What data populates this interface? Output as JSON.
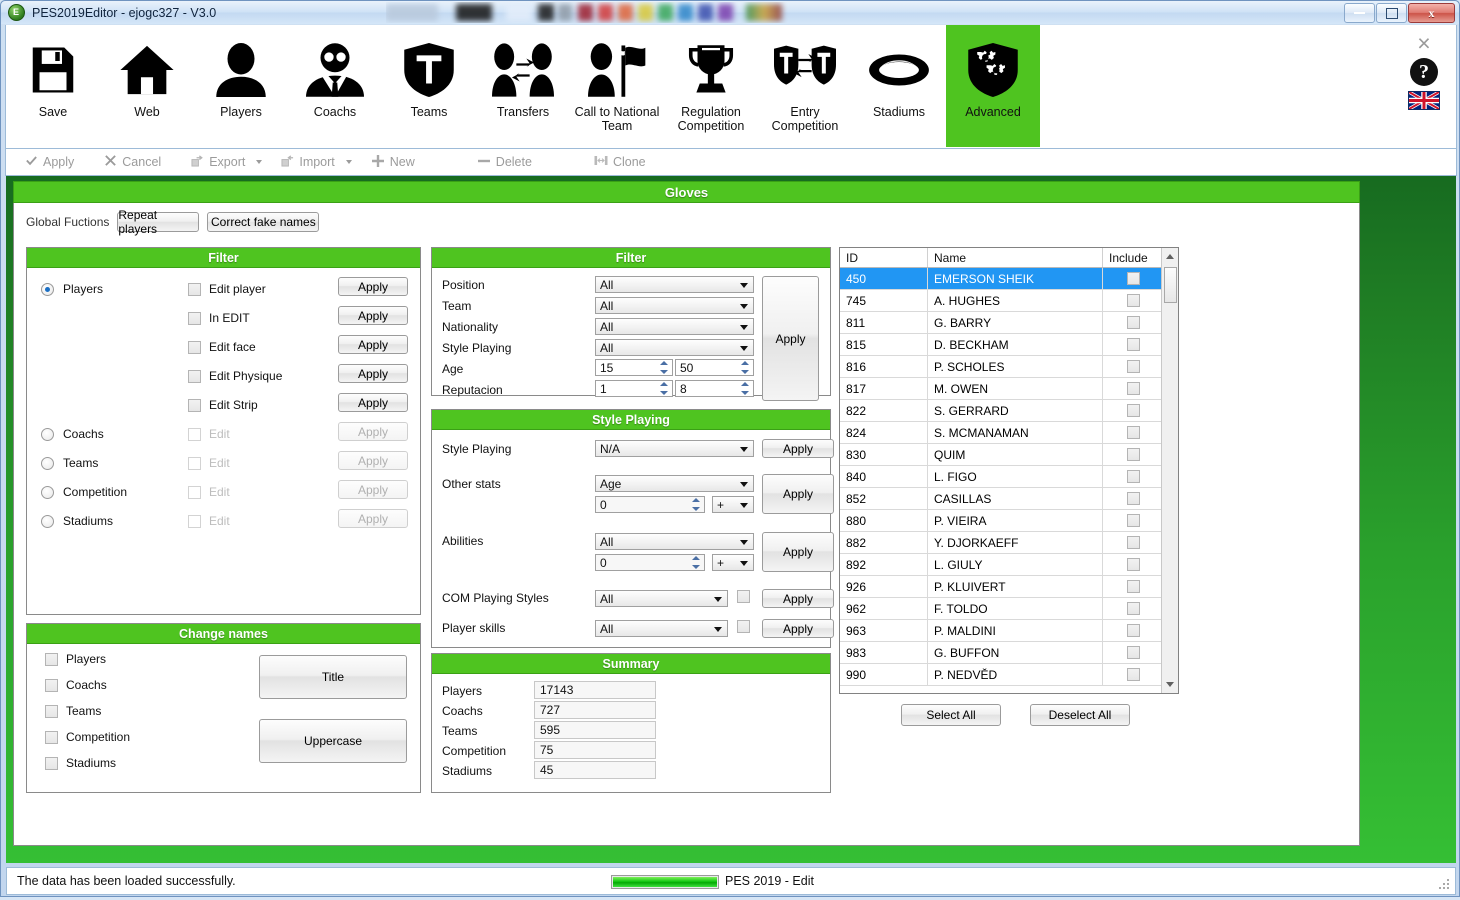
{
  "window": {
    "title": "PES2019Editor - ejogc327 - V3.0",
    "minimize_label": "Minimize",
    "maximize_label": "Maximize",
    "close_label": "x"
  },
  "toolbar": {
    "items": [
      {
        "label": "Save",
        "icon": "floppy-disk-icon"
      },
      {
        "label": "Web",
        "icon": "home-icon"
      },
      {
        "label": "Players",
        "icon": "person-icon"
      },
      {
        "label": "Coachs",
        "icon": "coach-suit-icon"
      },
      {
        "label": "Teams",
        "icon": "shield-t-icon"
      },
      {
        "label": "Transfers",
        "icon": "two-people-swap-icon"
      },
      {
        "label": "Call to National Team",
        "icon": "person-flag-icon"
      },
      {
        "label": "Regulation Competition",
        "icon": "trophy-icon"
      },
      {
        "label": "Entry Competition",
        "icon": "two-shields-swap-icon"
      },
      {
        "label": "Stadiums",
        "icon": "stadium-icon"
      },
      {
        "label": "Advanced",
        "icon": "shield-gears-icon",
        "active": true
      }
    ],
    "close_label": "×",
    "help_label": "?",
    "language_flag": "union-jack-flag"
  },
  "commandbar": {
    "items": [
      {
        "label": "Apply",
        "icon": "check-icon",
        "dropdown": false
      },
      {
        "label": "Cancel",
        "icon": "cross-icon",
        "dropdown": false
      },
      {
        "label": "Export",
        "icon": "export-icon",
        "dropdown": true
      },
      {
        "label": "Import",
        "icon": "import-icon",
        "dropdown": true
      },
      {
        "label": "New",
        "icon": "plus-icon",
        "dropdown": false
      },
      {
        "label": "Delete",
        "icon": "minus-icon",
        "dropdown": false
      },
      {
        "label": "Clone",
        "icon": "clone-icon",
        "dropdown": false
      }
    ]
  },
  "page": {
    "header_title": "Gloves",
    "global_functions_label": "Global Fuctions",
    "global_buttons": [
      "Repeat players",
      "Correct fake names"
    ]
  },
  "filter_left": {
    "title": "Filter",
    "rows": [
      {
        "radio": "Players",
        "selected": true,
        "check": "Edit player",
        "apply": "Apply",
        "enabled": true
      },
      {
        "radio": "",
        "selected": false,
        "check": "In EDIT",
        "apply": "Apply",
        "enabled": true
      },
      {
        "radio": "",
        "selected": false,
        "check": "Edit face",
        "apply": "Apply",
        "enabled": true
      },
      {
        "radio": "",
        "selected": false,
        "check": "Edit Physique",
        "apply": "Apply",
        "enabled": true
      },
      {
        "radio": "",
        "selected": false,
        "check": "Edit Strip",
        "apply": "Apply",
        "enabled": true
      },
      {
        "radio": "Coachs",
        "selected": false,
        "check": "Edit",
        "apply": "Apply",
        "enabled": false
      },
      {
        "radio": "Teams",
        "selected": false,
        "check": "Edit",
        "apply": "Apply",
        "enabled": false
      },
      {
        "radio": "Competition",
        "selected": false,
        "check": "Edit",
        "apply": "Apply",
        "enabled": false
      },
      {
        "radio": "Stadiums",
        "selected": false,
        "check": "Edit",
        "apply": "Apply",
        "enabled": false
      }
    ]
  },
  "change_names": {
    "title": "Change names",
    "checks": [
      "Players",
      "Coachs",
      "Teams",
      "Competition",
      "Stadiums"
    ],
    "buttons": [
      "Title",
      "Uppercase"
    ]
  },
  "filter_center": {
    "title": "Filter",
    "apply_label": "Apply",
    "fields": [
      {
        "label": "Position",
        "value": "All",
        "type": "combo"
      },
      {
        "label": "Team",
        "value": "All",
        "type": "combo"
      },
      {
        "label": "Nationality",
        "value": "All",
        "type": "combo"
      },
      {
        "label": "Style Playing",
        "value": "All",
        "type": "combo"
      }
    ],
    "ranges": [
      {
        "label": "Age",
        "min": "15",
        "max": "50"
      },
      {
        "label": "Reputacion",
        "min": "1",
        "max": "8"
      }
    ]
  },
  "style_playing": {
    "title": "Style Playing",
    "style_label": "Style Playing",
    "style_value": "N/A",
    "style_apply": "Apply",
    "other_stats_label": "Other stats",
    "other_stats_value": "Age",
    "other_stats_number": "0",
    "other_stats_op": "+",
    "other_stats_apply": "Apply",
    "abilities_label": "Abilities",
    "abilities_value": "All",
    "abilities_number": "0",
    "abilities_op": "+",
    "abilities_apply": "Apply",
    "com_label": "COM Playing Styles",
    "com_value": "All",
    "com_apply": "Apply",
    "skills_label": "Player skills",
    "skills_value": "All",
    "skills_apply": "Apply"
  },
  "summary": {
    "title": "Summary",
    "rows": [
      {
        "label": "Players",
        "value": "17143"
      },
      {
        "label": "Coachs",
        "value": "727"
      },
      {
        "label": "Teams",
        "value": "595"
      },
      {
        "label": "Competition",
        "value": "75"
      },
      {
        "label": "Stadiums",
        "value": "45"
      }
    ]
  },
  "player_table": {
    "columns": [
      "ID",
      "Name",
      "Include"
    ],
    "rows": [
      {
        "id": "450",
        "name": "EMERSON SHEIK",
        "include": false,
        "selected": true
      },
      {
        "id": "745",
        "name": "A. HUGHES",
        "include": false,
        "selected": false
      },
      {
        "id": "811",
        "name": "G. BARRY",
        "include": false,
        "selected": false
      },
      {
        "id": "815",
        "name": "D. BECKHAM",
        "include": false,
        "selected": false
      },
      {
        "id": "816",
        "name": "P. SCHOLES",
        "include": false,
        "selected": false
      },
      {
        "id": "817",
        "name": "M. OWEN",
        "include": false,
        "selected": false
      },
      {
        "id": "822",
        "name": "S. GERRARD",
        "include": false,
        "selected": false
      },
      {
        "id": "824",
        "name": "S. MCMANAMAN",
        "include": false,
        "selected": false
      },
      {
        "id": "830",
        "name": "QUIM",
        "include": false,
        "selected": false
      },
      {
        "id": "840",
        "name": "L. FIGO",
        "include": false,
        "selected": false
      },
      {
        "id": "852",
        "name": "CASILLAS",
        "include": false,
        "selected": false
      },
      {
        "id": "880",
        "name": "P. VIEIRA",
        "include": false,
        "selected": false
      },
      {
        "id": "882",
        "name": "Y. DJORKAEFF",
        "include": false,
        "selected": false
      },
      {
        "id": "892",
        "name": "L. GIULY",
        "include": false,
        "selected": false
      },
      {
        "id": "926",
        "name": "P. KLUIVERT",
        "include": false,
        "selected": false
      },
      {
        "id": "962",
        "name": "F. TOLDO",
        "include": false,
        "selected": false
      },
      {
        "id": "963",
        "name": "P. MALDINI",
        "include": false,
        "selected": false
      },
      {
        "id": "983",
        "name": "G. BUFFON",
        "include": false,
        "selected": false
      },
      {
        "id": "990",
        "name": "P. NEDVĚD",
        "include": false,
        "selected": false
      }
    ],
    "select_all_label": "Select All",
    "deselect_all_label": "Deselect All"
  },
  "status": {
    "message": "The data has been loaded successfully.",
    "progress_percent": 100,
    "mode": "PES 2019 - Edit"
  },
  "colors": {
    "accent_green": "#4fc420",
    "selection_blue": "#2196f3",
    "body_green_top": "#176b20",
    "body_green_bottom": "#35bf34"
  }
}
